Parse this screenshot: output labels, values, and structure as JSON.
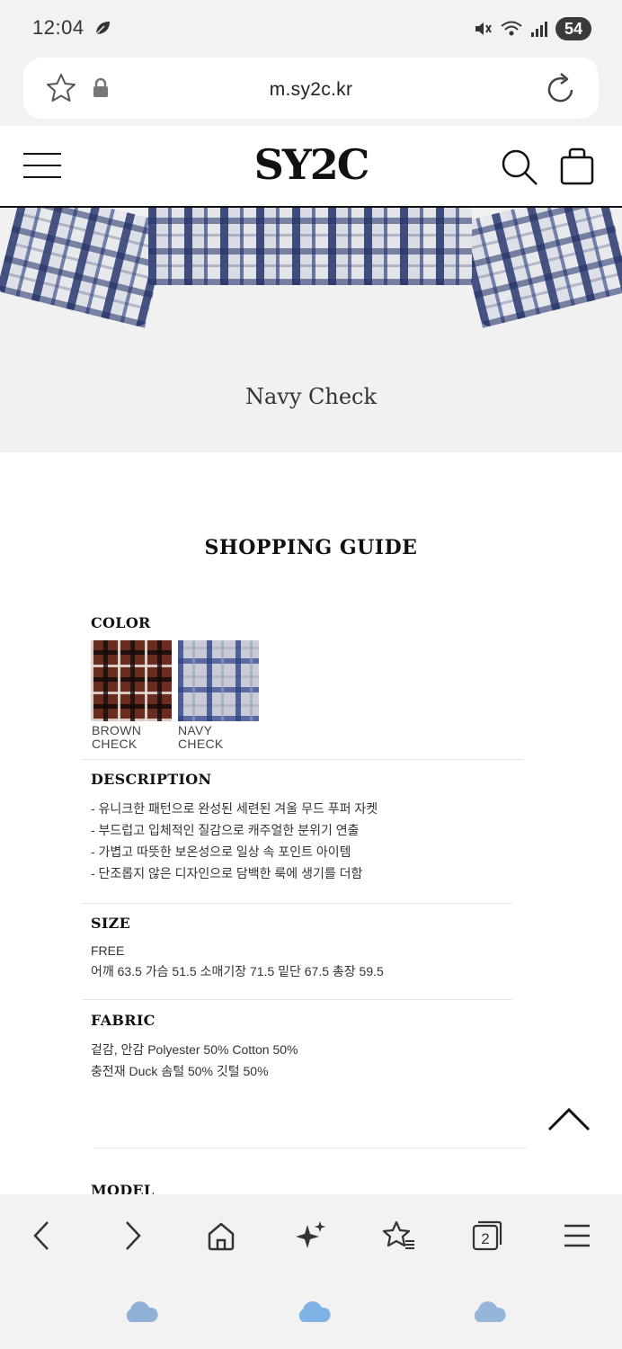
{
  "status_bar": {
    "time": "12:04",
    "battery": "54"
  },
  "browser": {
    "url": "m.sy2c.kr",
    "tabs_count": "2"
  },
  "site": {
    "logo": "SY2C"
  },
  "product": {
    "caption": "Navy Check"
  },
  "guide": {
    "title": "SHOPPING GUIDE",
    "color": {
      "heading": "COLOR",
      "swatches": [
        {
          "label": "BROWN\nCHECK",
          "color": "#6a2c1f"
        },
        {
          "label": "NAVY\nCHECK",
          "color": "#3d4f8c"
        }
      ]
    },
    "description": {
      "heading": "DESCRIPTION",
      "lines": [
        "- 유니크한 패턴으로 완성된 세련된 겨울 무드 푸퍼 자켓",
        "- 부드럽고 입체적인 질감으로 캐주얼한 분위기 연출",
        "- 가볍고 따뜻한 보온성으로 일상 속 포인트 아이템",
        "- 단조롭지 않은 디자인으로 담백한 룩에 생기를 더함"
      ]
    },
    "size": {
      "heading": "SIZE",
      "lines": [
        "FREE",
        "어깨 63.5 가슴 51.5 소매기장 71.5 밑단 67.5 총장 59.5"
      ]
    },
    "fabric": {
      "heading": "FABRIC",
      "lines": [
        "겉감, 안감 Polyester 50% Cotton 50%",
        "충전재 Duck 솜털 50% 깃털 50%"
      ]
    },
    "model": {
      "heading": "MODEL"
    }
  }
}
